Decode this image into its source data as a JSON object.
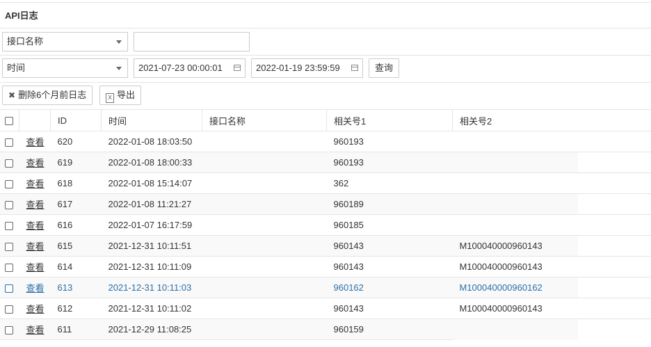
{
  "page": {
    "title": "API日志"
  },
  "filters": {
    "interface_select": "接口名称",
    "interface_input": "",
    "time_select": "时间",
    "start_time": "2021-07-23 00:00:01",
    "end_time": "2022-01-19 23:59:59",
    "query_label": "查询"
  },
  "toolbar": {
    "delete_label": "删除6个月前日志",
    "export_label": "导出"
  },
  "table": {
    "headers": [
      "ID",
      "时间",
      "接口名称",
      "相关号1",
      "相关号2"
    ],
    "view_label": "查看",
    "rows": [
      {
        "id": "620",
        "time": "2022-01-08 18:03:50",
        "name": "",
        "ref1": "960193",
        "ref2": ""
      },
      {
        "id": "619",
        "time": "2022-01-08 18:00:33",
        "name": "",
        "ref1": "960193",
        "ref2": ""
      },
      {
        "id": "618",
        "time": "2022-01-08 15:14:07",
        "name": "",
        "ref1": "362",
        "ref2": ""
      },
      {
        "id": "617",
        "time": "2022-01-08 11:21:27",
        "name": "",
        "ref1": "960189",
        "ref2": ""
      },
      {
        "id": "616",
        "time": "2022-01-07 16:17:59",
        "name": "",
        "ref1": "960185",
        "ref2": ""
      },
      {
        "id": "615",
        "time": "2021-12-31 10:11:51",
        "name": "",
        "ref1": "960143",
        "ref2": "M100040000960143"
      },
      {
        "id": "614",
        "time": "2021-12-31 10:11:09",
        "name": "",
        "ref1": "960143",
        "ref2": "M100040000960143"
      },
      {
        "id": "613",
        "time": "2021-12-31 10:11:03",
        "name": "",
        "ref1": "960162",
        "ref2": "M100040000960162"
      },
      {
        "id": "612",
        "time": "2021-12-31 10:11:02",
        "name": "",
        "ref1": "960143",
        "ref2": "M100040000960143"
      },
      {
        "id": "611",
        "time": "2021-12-29 11:08:25",
        "name": "",
        "ref1": "960159",
        "ref2": ""
      }
    ]
  }
}
